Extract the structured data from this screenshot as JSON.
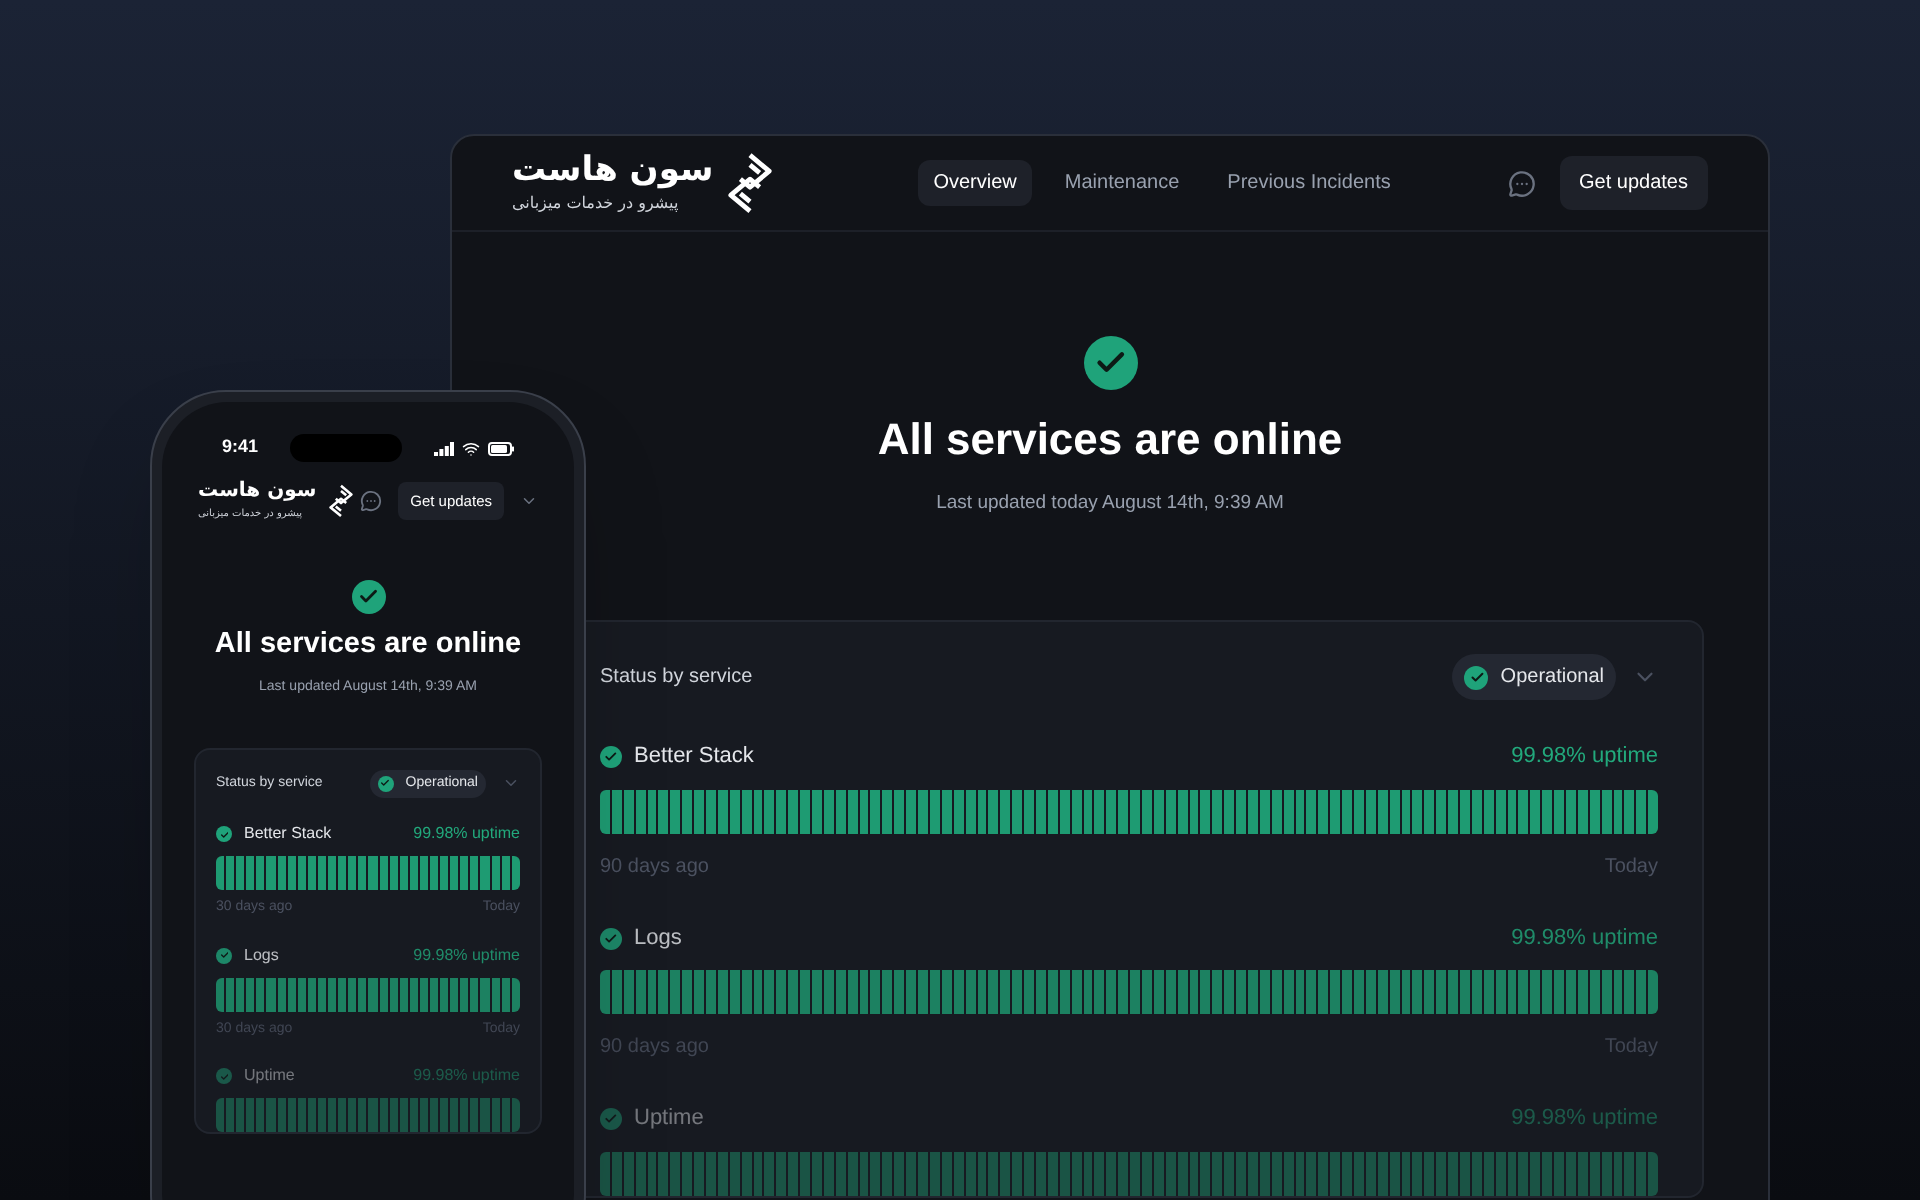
{
  "desktop": {
    "brand": {
      "name": "سون هاست",
      "tagline": "پیشرو در خدمات میزبانی"
    },
    "nav": [
      {
        "label": "Overview",
        "selected": true
      },
      {
        "label": "Maintenance",
        "selected": false
      },
      {
        "label": "Previous Incidents",
        "selected": false
      }
    ],
    "subscribe_button": "Get updates",
    "hero": {
      "title": "All services are online",
      "subtitle": "Last updated today August 14th, 9:39 AM"
    },
    "status_card": {
      "title": "Status by service",
      "badge": "Operational",
      "services": [
        {
          "name": "Better Stack",
          "uptime": "99.98% uptime",
          "start_label": "90 days ago",
          "end_label": "Today"
        },
        {
          "name": "Logs",
          "uptime": "99.98% uptime",
          "start_label": "90 days ago",
          "end_label": "Today"
        },
        {
          "name": "Uptime",
          "uptime": "99.98% uptime"
        }
      ]
    }
  },
  "phone": {
    "status_bar": {
      "time": "9:41"
    },
    "brand": {
      "name": "سون هاست",
      "tagline": "پیشرو در خدمات میزبانی"
    },
    "subscribe_button": "Get updates",
    "hero": {
      "title": "All services are online",
      "subtitle": "Last updated August 14th, 9:39 AM"
    },
    "status_card": {
      "title": "Status by service",
      "badge": "Operational",
      "services": [
        {
          "name": "Better Stack",
          "uptime": "99.98% uptime",
          "start_label": "30 days ago",
          "end_label": "Today"
        },
        {
          "name": "Logs",
          "uptime": "99.98% uptime",
          "start_label": "30 days ago",
          "end_label": "Today"
        },
        {
          "name": "Uptime",
          "uptime": "99.98% uptime"
        }
      ]
    }
  }
}
